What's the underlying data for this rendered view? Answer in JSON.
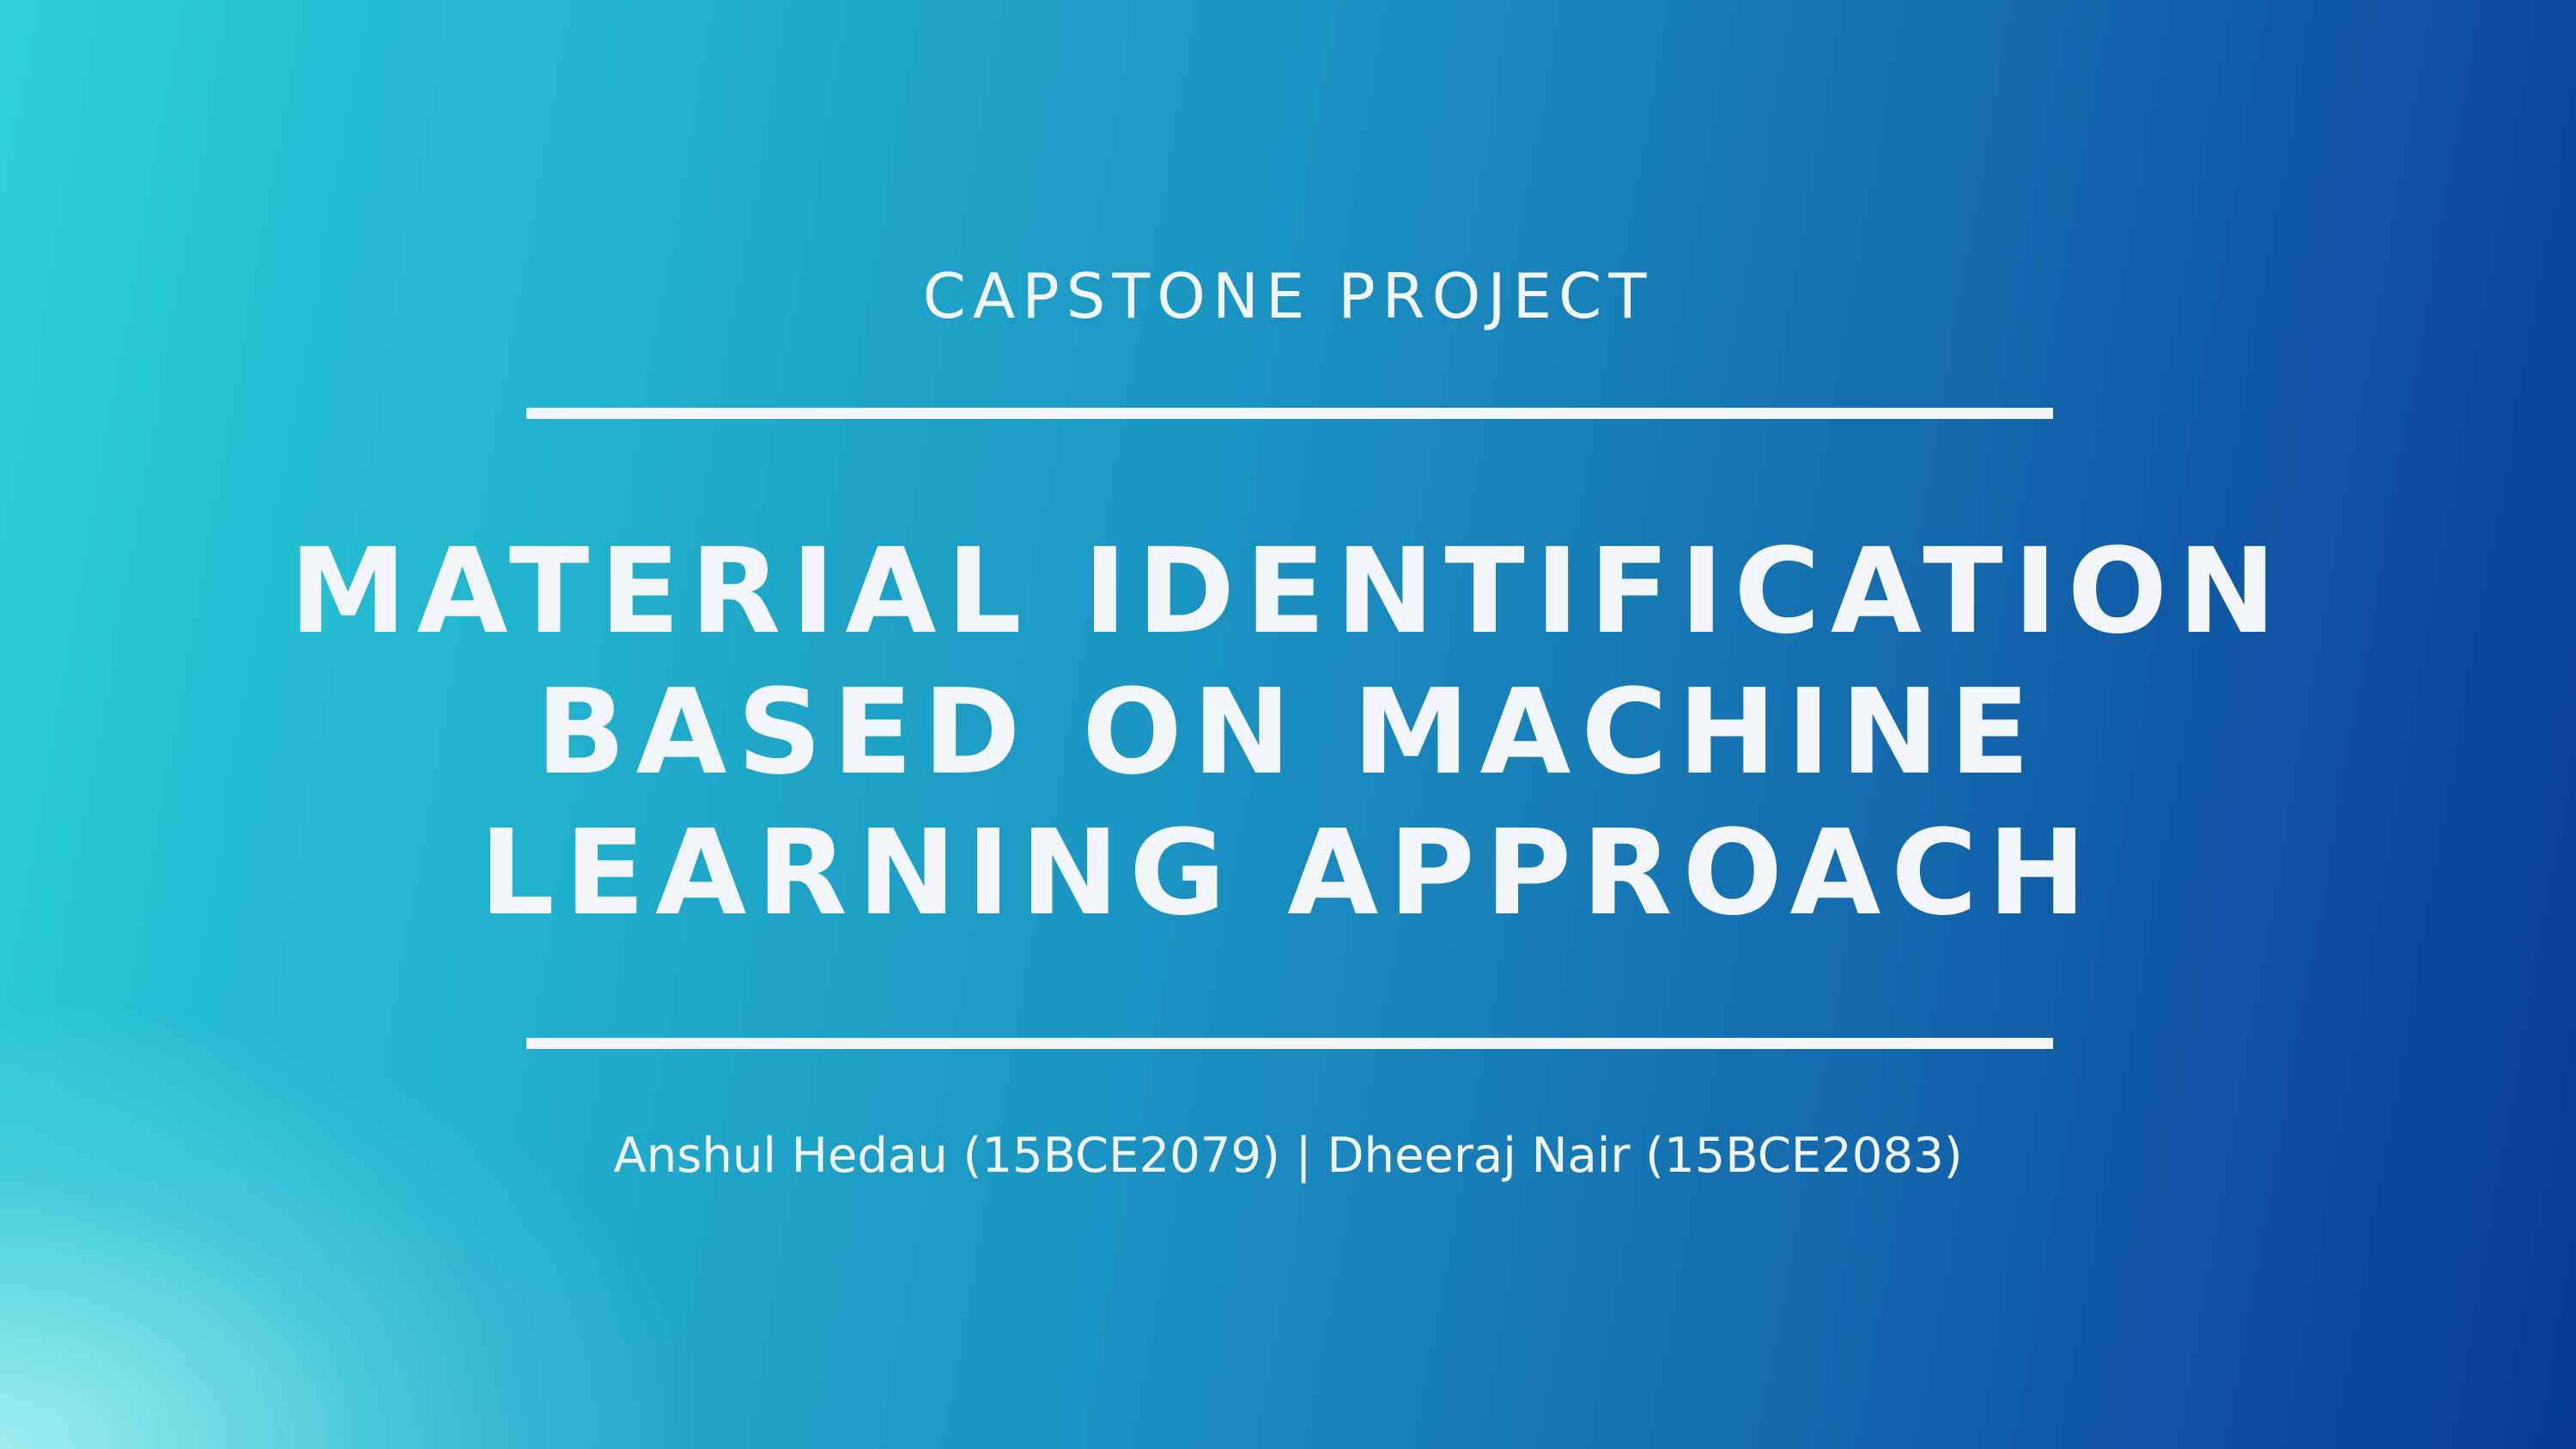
{
  "slide": {
    "subtitle": "CAPSTONE PROJECT",
    "title_lines": [
      "MATERIAL IDENTIFICATION",
      "BASED ON MACHINE",
      "LEARNING APPROACH"
    ],
    "authors": "Anshul Hedau (15BCE2079) | Dheeraj Nair (15BCE2083)"
  },
  "colors": {
    "text": "#f2f6fb",
    "gradient_start": "#2dcfd8",
    "gradient_end": "#0a3a96"
  }
}
